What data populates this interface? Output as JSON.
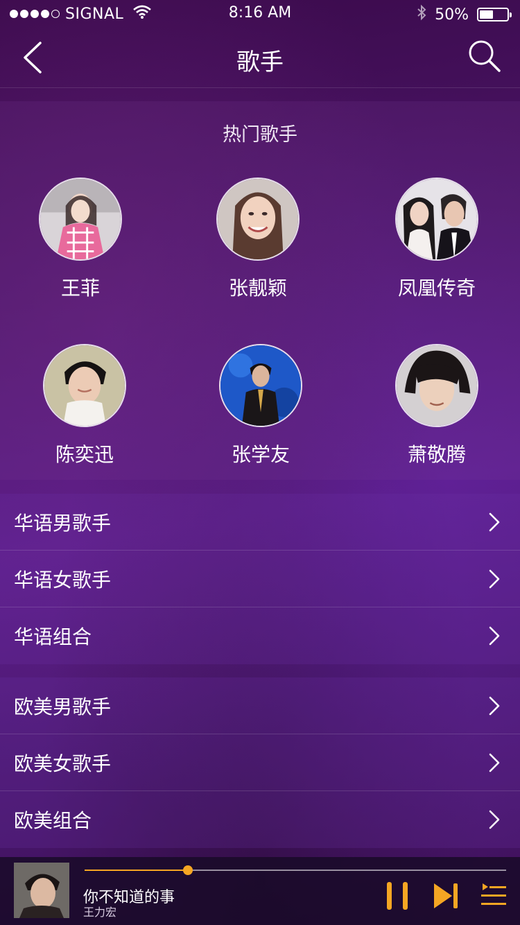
{
  "status_bar": {
    "carrier": "SIGNAL",
    "time": "8:16 AM",
    "battery": "50%",
    "battery_level": 0.5
  },
  "nav": {
    "title": "歌手",
    "back_icon": "chevron-left-icon",
    "search_icon": "search-icon"
  },
  "hot_singers": {
    "title": "热门歌手",
    "artists": [
      {
        "name": "王菲"
      },
      {
        "name": "张靓颖"
      },
      {
        "name": "凤凰传奇"
      },
      {
        "name": "陈奕迅"
      },
      {
        "name": "张学友"
      },
      {
        "name": "萧敬腾"
      }
    ]
  },
  "chinese_categories": [
    {
      "label": "华语男歌手"
    },
    {
      "label": "华语女歌手"
    },
    {
      "label": "华语组合"
    }
  ],
  "western_categories": [
    {
      "label": "欧美男歌手"
    },
    {
      "label": "欧美女歌手"
    },
    {
      "label": "欧美组合"
    }
  ],
  "player": {
    "song_title": "你不知道的事",
    "artist": "王力宏",
    "progress": 0.245,
    "accent_color": "#f5a623",
    "controls": [
      "pause-icon",
      "next-icon",
      "playlist-icon"
    ]
  }
}
